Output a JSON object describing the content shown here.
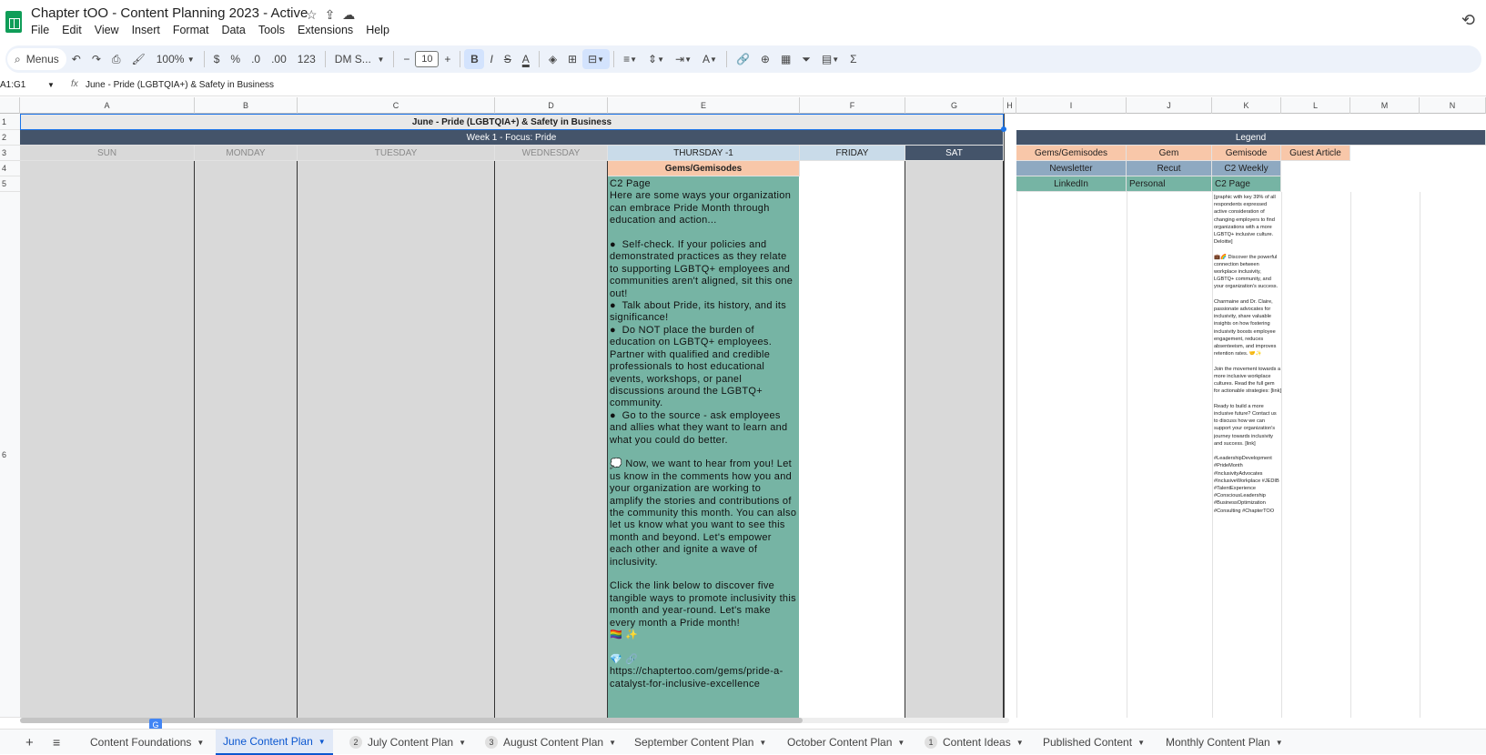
{
  "app": {
    "title": "Chapter tOO - Content Planning 2023 - Active",
    "menu": [
      "File",
      "Edit",
      "View",
      "Insert",
      "Format",
      "Data",
      "Tools",
      "Extensions",
      "Help"
    ]
  },
  "toolbar": {
    "menus_label": "Menus",
    "zoom": "100%",
    "currency": "$",
    "percent": "%",
    "dec_decrease": ".0",
    "dec_increase": ".00",
    "number_format": "123",
    "font": "DM S...",
    "font_size": "10",
    "bold": "B",
    "italic": "I",
    "strike": "S",
    "text_color": "A",
    "sum": "Σ"
  },
  "formula_bar": {
    "name_box": "A1:G1",
    "fx": "fx",
    "value": "June - Pride (LGBTQIA+) & Safety in Business"
  },
  "columns": [
    "A",
    "B",
    "C",
    "D",
    "E",
    "F",
    "G",
    "H",
    "I",
    "J",
    "K",
    "L",
    "M",
    "N"
  ],
  "rows": [
    "1",
    "2",
    "3",
    "4",
    "5",
    "6"
  ],
  "sheet": {
    "month_title": "June - Pride (LGBTQIA+) & Safety in Business",
    "week_title": "Week 1 - Focus: Pride",
    "days": [
      "SUN",
      "MONDAY",
      "TUESDAY",
      "WEDNESDAY",
      "THURSDAY -1",
      "FRIDAY",
      "SAT"
    ],
    "thursday_type": "Gems/Gemisodes",
    "post_text": "C2 Page\nHere are some ways your organization can embrace Pride Month through education and action...\n\n●  Self-check. If your policies and demonstrated practices as they relate to supporting LGBTQ+ employees and communities aren't aligned, sit this one out!\n●  Talk about Pride, its history, and its significance!\n●  Do NOT place the burden of education on LGBTQ+ employees. Partner with qualified and credible professionals to host educational events, workshops, or panel discussions around the LGBTQ+ community.\n●  Go to the source - ask employees and allies what they want to learn and what you could do better.\n\n💭 Now, we want to hear from you! Let us know in the comments how you and your organization are working to amplify the stories and contributions of the community this month. You can also let us know what you want to see this month and beyond. Let's empower each other and ignite a wave of inclusivity.\n\nClick the link below to discover five tangible ways to promote inclusivity this month and year-round. Let's make every month a Pride month!\n🏳️‍🌈 ✨\n\n💎 🔗 https://chaptertoo.com/gems/pride-a-catalyst-for-inclusive-excellence"
  },
  "legend": {
    "title": "Legend",
    "row3": [
      "Gems/Gemisodes",
      "Gem",
      "Gemisode",
      "Guest Article"
    ],
    "row4": [
      "Newsletter",
      "Recut",
      "C2 Weekly"
    ],
    "row5": [
      "LinkedIn",
      "Personal",
      "C2 Page"
    ]
  },
  "k6_text": "[graphic with key 39% of all respondents expressed active consideration of changing employers to find organizations with a more LGBTQ+ inclusive culture. Deloitte]\n\n💼🌈 Discover the powerful connection between workplace inclusivity, LGBTQ+ community, and your organization's success.\n\nCharmaine and Dr. Claire, passionate advocates for inclusivity, share valuable insights on how fostering inclusivity boosts employee engagement, reduces absenteeism, and improves retention rates. 🤝✨\n\nJoin the movement towards a more inclusive workplace cultures. Read the full gem for actionable strategies: [link]\n\nReady to build a more inclusive future? Contact us to discuss how we can support your organization's journey towards inclusivity and success. [link]\n\n#LeadershipDevelopment #PrideMonth #InclusivityAdvocates #InclusiveWorkplace #JEDIB #TalentExperience #ConsciousLeadership #BusinessOptimization #Consulting #ChapterTOO",
  "tabs": [
    {
      "label": "Content Foundations",
      "badge": ""
    },
    {
      "label": "June Content Plan",
      "badge": ""
    },
    {
      "label": "July Content Plan",
      "badge": "2"
    },
    {
      "label": "August Content Plan",
      "badge": "3"
    },
    {
      "label": "September Content Plan",
      "badge": ""
    },
    {
      "label": "October Content Plan",
      "badge": ""
    },
    {
      "label": "Content Ideas",
      "badge": "1"
    },
    {
      "label": "Published Content",
      "badge": ""
    },
    {
      "label": "Monthly Content Plan",
      "badge": ""
    }
  ],
  "colors": {
    "dark_header": "#44546a",
    "peach": "#f8c7a9",
    "teal": "#76b4a4",
    "bluegray": "#8ea9c1",
    "accent": "#0b57d0"
  }
}
